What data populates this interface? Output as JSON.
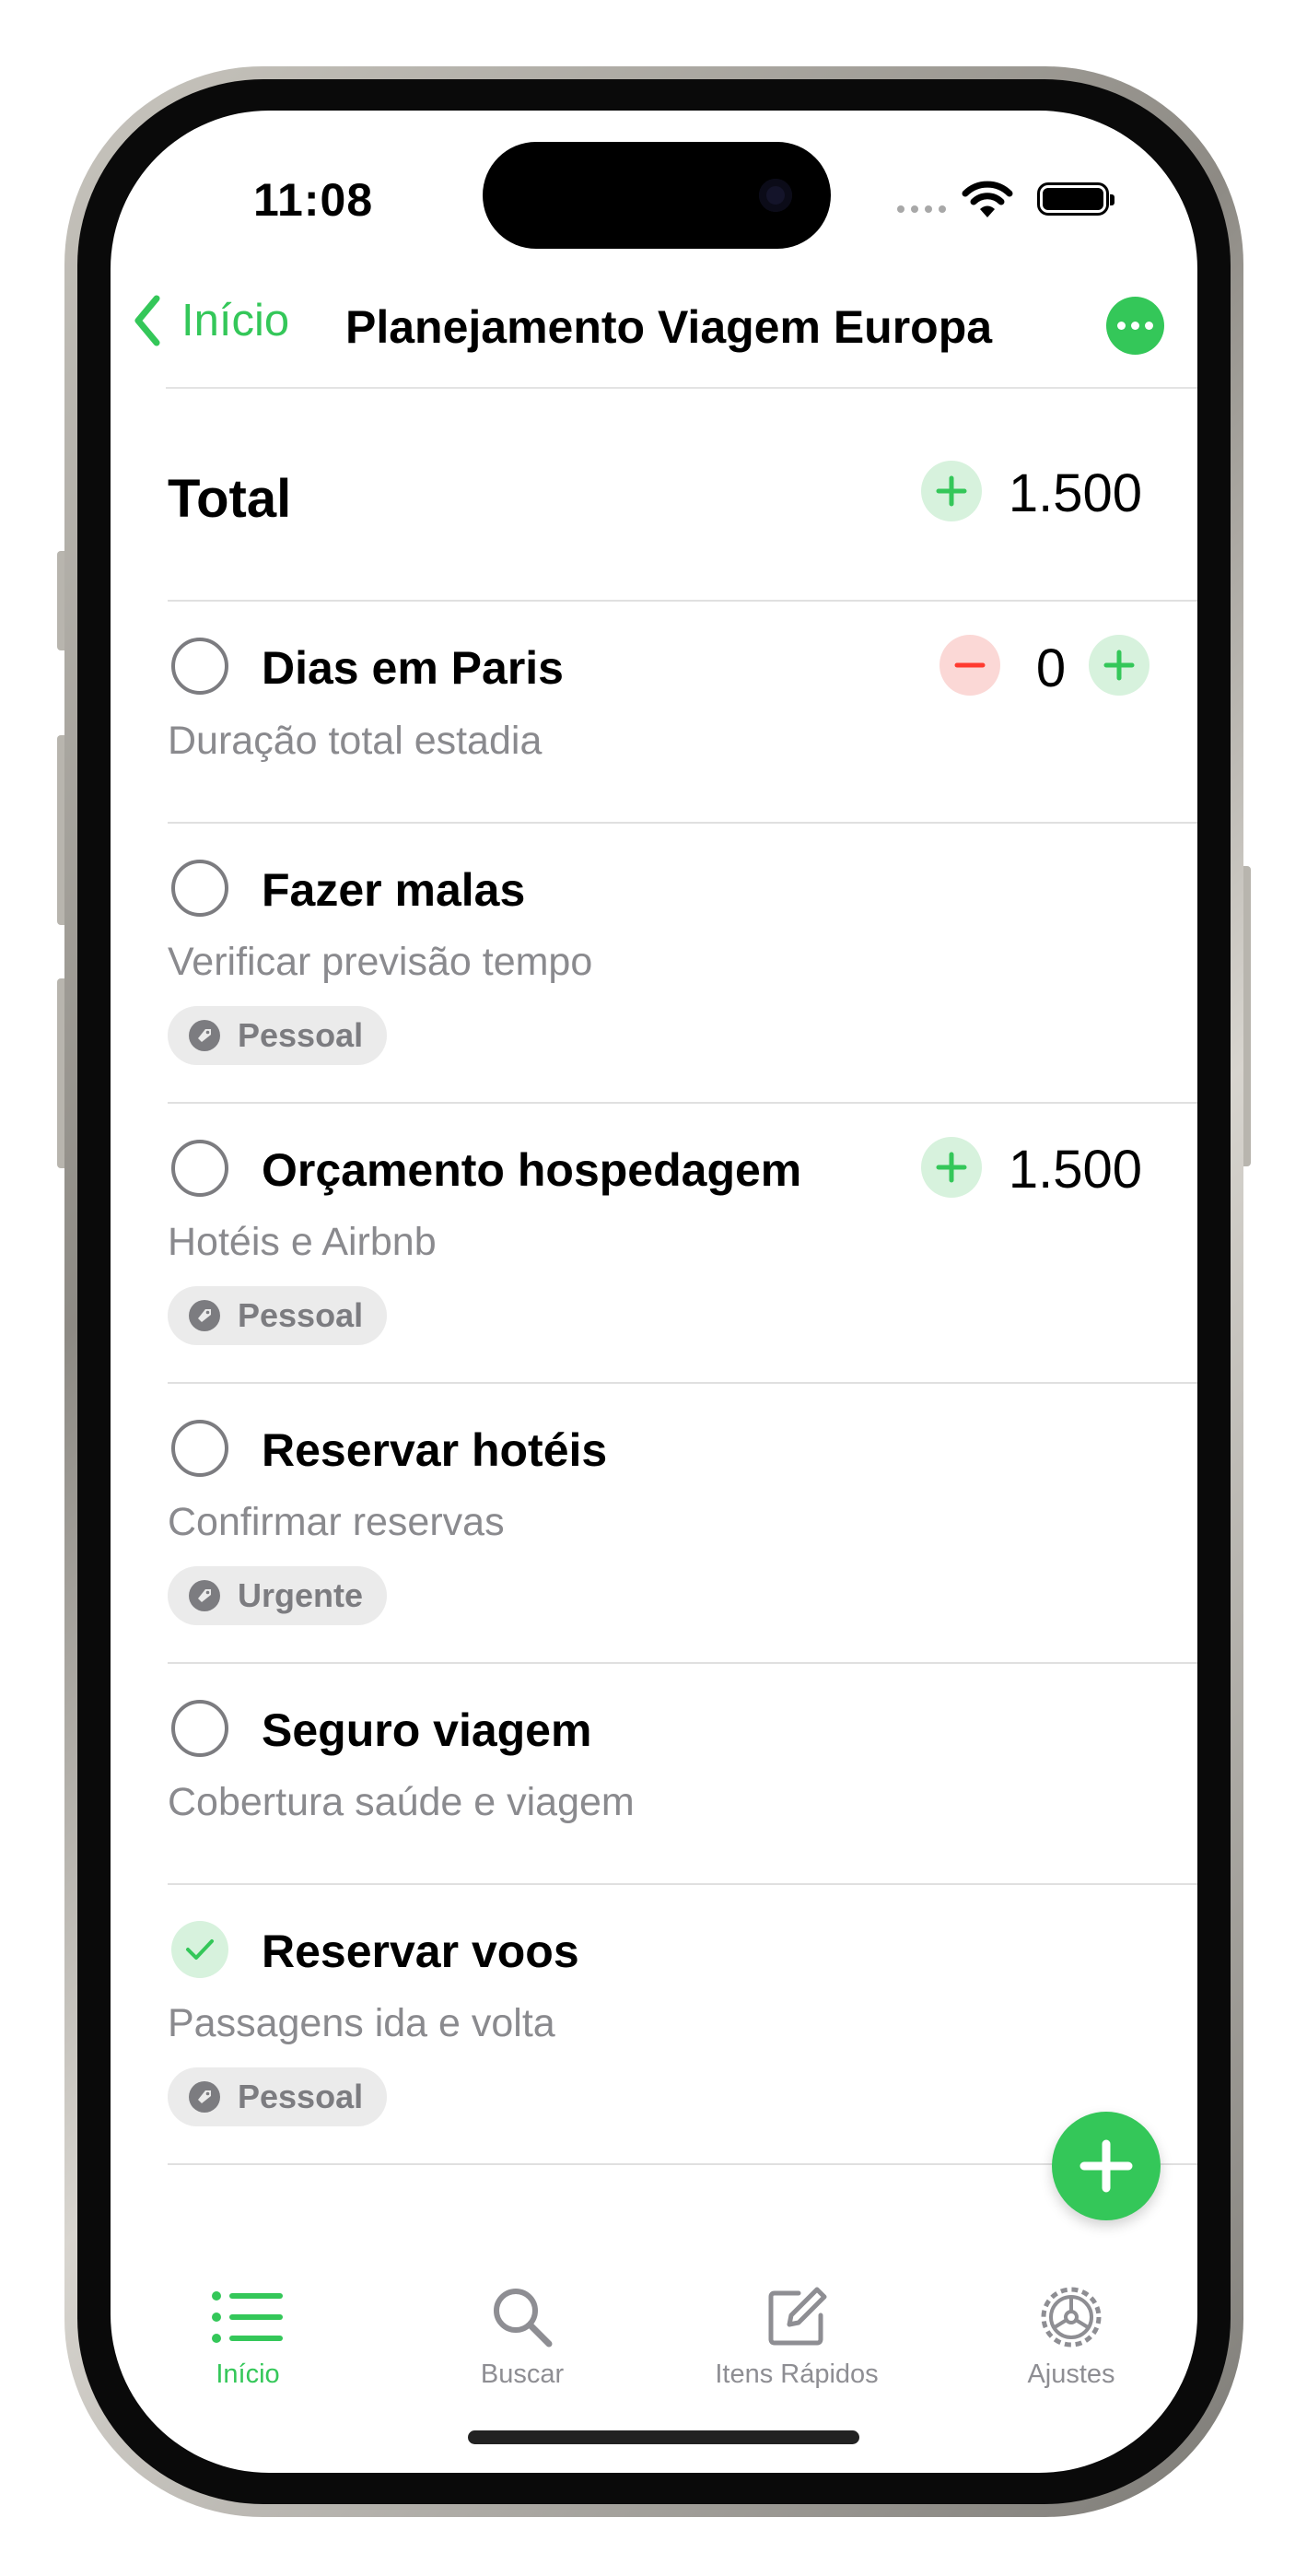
{
  "status_bar": {
    "time": "11:08"
  },
  "nav": {
    "back_label": "Início",
    "title": "Planejamento Viagem Europa",
    "more_icon": "ellipsis-circle-icon"
  },
  "total": {
    "label": "Total",
    "value": "1.500"
  },
  "items": [
    {
      "title": "Dias em Paris",
      "subtitle": "Duração total estadia",
      "checked": false,
      "counter": "0"
    },
    {
      "title": "Fazer malas",
      "subtitle": "Verificar previsão tempo",
      "checked": false,
      "tag": "Pessoal"
    },
    {
      "title": "Orçamento hospedagem",
      "subtitle": "Hotéis e Airbnb",
      "checked": false,
      "amount": "1.500",
      "tag": "Pessoal"
    },
    {
      "title": "Reservar hotéis",
      "subtitle": "Confirmar reservas",
      "checked": false,
      "tag": "Urgente"
    },
    {
      "title": "Seguro viagem",
      "subtitle": "Cobertura saúde e viagem",
      "checked": false
    },
    {
      "title": "Reservar voos",
      "subtitle": "Passagens ida e volta",
      "checked": true,
      "tag": "Pessoal"
    }
  ],
  "tabbar": {
    "tabs": [
      {
        "label": "Início",
        "icon": "list-icon",
        "active": true
      },
      {
        "label": "Buscar",
        "icon": "search-icon",
        "active": false
      },
      {
        "label": "Itens Rápidos",
        "icon": "compose-icon",
        "active": false
      },
      {
        "label": "Ajustes",
        "icon": "gear-icon",
        "active": false
      }
    ]
  },
  "colors": {
    "accent": "#34c759",
    "danger": "#ff3b30",
    "secondary_text": "#8a8a8e"
  }
}
